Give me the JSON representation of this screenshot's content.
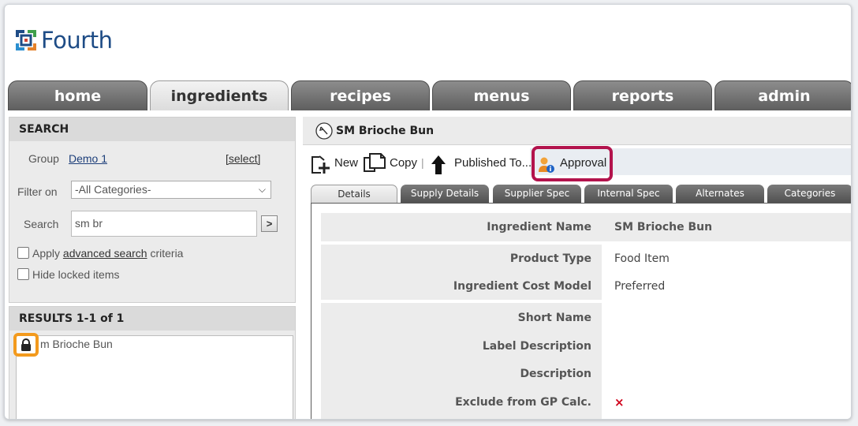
{
  "brand": {
    "name": "Fourth"
  },
  "nav": {
    "tabs": [
      {
        "label": "home",
        "active": false
      },
      {
        "label": "ingredients",
        "active": true
      },
      {
        "label": "recipes",
        "active": false
      },
      {
        "label": "menus",
        "active": false
      },
      {
        "label": "reports",
        "active": false
      },
      {
        "label": "admin",
        "active": false
      }
    ]
  },
  "search": {
    "header": "SEARCH",
    "group_label": "Group",
    "group_value": "Demo 1",
    "select_link": "[select]",
    "filter_label": "Filter on",
    "filter_value": "-All Categories-",
    "search_label": "Search",
    "search_value": "sm br",
    "go_icon": "chevron-right-icon",
    "apply_prefix": "Apply ",
    "apply_link": "advanced search",
    "apply_suffix": " criteria",
    "hide_locked_label": "Hide locked items"
  },
  "results": {
    "header": "RESULTS 1-1 of 1",
    "items": [
      {
        "label": "SM Brioche Bun",
        "visible_text": "m Brioche Bun",
        "locked": true
      }
    ]
  },
  "main": {
    "title": "SM Brioche Bun",
    "toolbar": {
      "new_label": "New",
      "copy_label": "Copy",
      "separator": "|",
      "published_label": "Published To...",
      "approval_label": "Approval"
    },
    "subtabs": [
      {
        "label": "Details",
        "active": true
      },
      {
        "label": "Supply Details",
        "active": false
      },
      {
        "label": "Supplier Spec",
        "active": false
      },
      {
        "label": "Internal Spec",
        "active": false
      },
      {
        "label": "Alternates",
        "active": false
      },
      {
        "label": "Categories",
        "active": false
      }
    ],
    "fields": {
      "ingredient_name": {
        "label": "Ingredient Name",
        "value": "SM Brioche Bun"
      },
      "product_type": {
        "label": "Product Type",
        "value": "Food Item"
      },
      "cost_model": {
        "label": "Ingredient Cost Model",
        "value": "Preferred"
      },
      "short_name": {
        "label": "Short Name",
        "value": ""
      },
      "label_description": {
        "label": "Label Description",
        "value": ""
      },
      "description": {
        "label": "Description",
        "value": ""
      },
      "exclude_gp": {
        "label": "Exclude from GP Calc.",
        "value": "×"
      }
    }
  },
  "colors": {
    "brand_blue": "#1e4c86",
    "approval_highlight": "#b3134c",
    "lock_highlight": "#f39a1d",
    "exclude_x": "#d0021b"
  }
}
